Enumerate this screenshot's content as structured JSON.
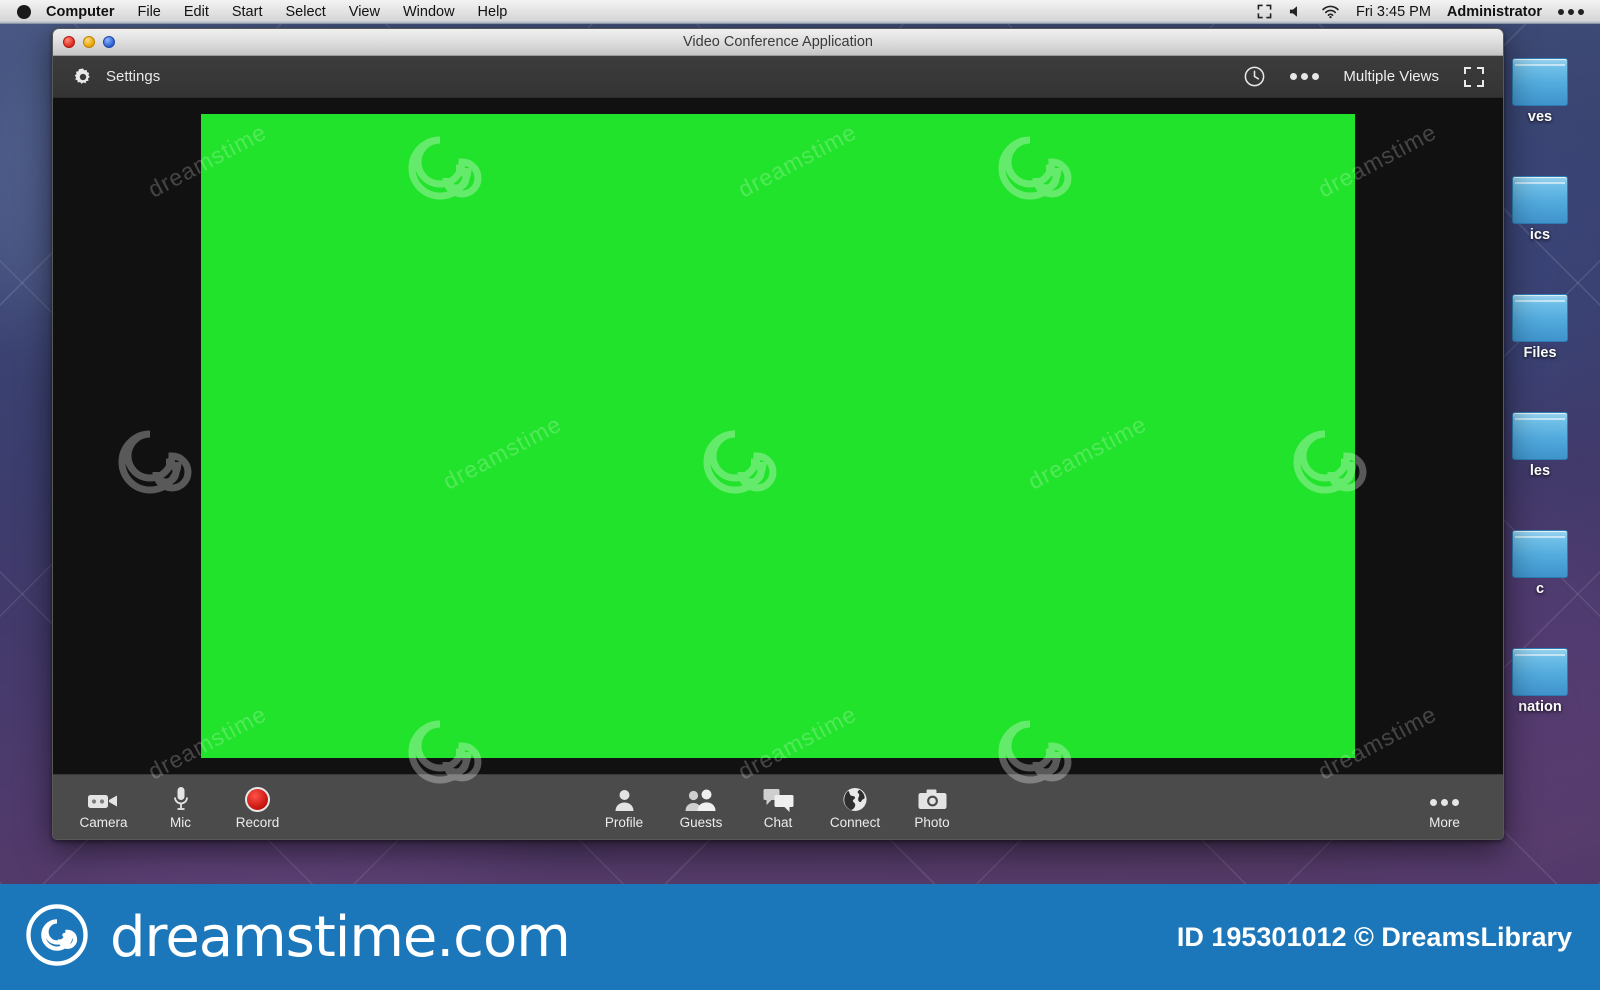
{
  "menubar": {
    "apple_icon": "apple-logo-icon",
    "items": [
      {
        "label": "Computer",
        "bold": true
      },
      {
        "label": "File",
        "bold": false
      },
      {
        "label": "Edit",
        "bold": false
      },
      {
        "label": "Start",
        "bold": false
      },
      {
        "label": "Select",
        "bold": false
      },
      {
        "label": "View",
        "bold": false
      },
      {
        "label": "Window",
        "bold": false
      },
      {
        "label": "Help",
        "bold": false
      }
    ],
    "status": {
      "fullscreen_icon": "expand-icon",
      "volume_icon": "speaker-icon",
      "wifi_icon": "wifi-icon",
      "clock": "Fri 3:45 PM",
      "user": "Administrator",
      "overflow_icon": "ellipsis-icon"
    }
  },
  "window": {
    "title": "Video Conference Application",
    "traffic_lights": [
      "close",
      "minimize",
      "zoom"
    ],
    "toolbar": {
      "settings_icon": "gear-icon",
      "settings_label": "Settings",
      "clock_icon": "clock-icon",
      "more_icon": "ellipsis-icon",
      "views_label": "Multiple Views",
      "fullscreen_icon": "expand-icon"
    },
    "stage": {
      "green_screen_color": "#22e32b",
      "background_color": "#111111"
    },
    "bottom_toolbar": {
      "left": [
        {
          "label": "Camera",
          "icon": "video-camera-icon"
        },
        {
          "label": "Mic",
          "icon": "microphone-icon"
        },
        {
          "label": "Record",
          "icon": "record-icon"
        }
      ],
      "center": [
        {
          "label": "Profile",
          "icon": "person-icon"
        },
        {
          "label": "Guests",
          "icon": "people-icon"
        },
        {
          "label": "Chat",
          "icon": "chat-bubbles-icon"
        },
        {
          "label": "Connect",
          "icon": "globe-icon"
        },
        {
          "label": "Photo",
          "icon": "camera-icon"
        }
      ],
      "right": [
        {
          "label": "More",
          "icon": "ellipsis-icon"
        }
      ]
    }
  },
  "desktop": {
    "folders": [
      {
        "label": "ves"
      },
      {
        "label": "ics"
      },
      {
        "label": "Files"
      },
      {
        "label": "les"
      },
      {
        "label": "c"
      },
      {
        "label": "nation"
      }
    ]
  },
  "banner": {
    "logo_icon": "spiral-logo-icon",
    "brand": "dreamstime.com",
    "credit": "ID 195301012 © DreamsLibrary",
    "background_color": "#1b76ba"
  },
  "watermark": {
    "text": "dreamstime"
  }
}
